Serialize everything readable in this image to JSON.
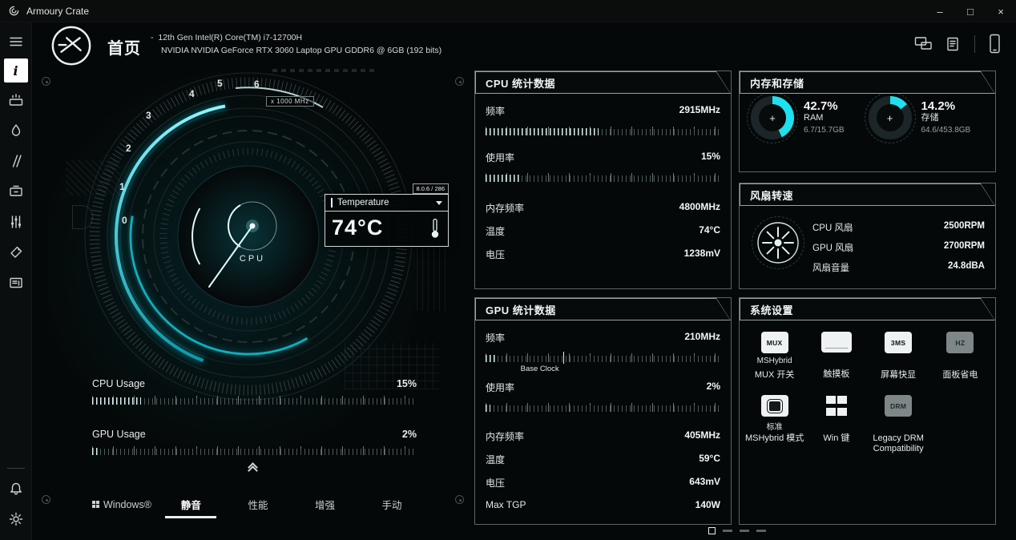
{
  "window": {
    "title": "Armoury Crate",
    "minimize": "–",
    "maximize": "□",
    "close": "×"
  },
  "header": {
    "page_title": "首页",
    "bullet": "-",
    "cpu_info": "12th Gen Intel(R) Core(TM) i7-12700H",
    "gpu_info": "NVIDIA NVIDIA GeForce RTX 3060 Laptop GPU GDDR6 @ 6GB (192 bits)"
  },
  "gauge": {
    "ticks": [
      "0",
      "1",
      "2",
      "3",
      "4",
      "5",
      "6"
    ],
    "scale_label": "x 1000 MHz",
    "center_label": "CPU",
    "tooltip": {
      "meta": "8.0.6 / 286",
      "title": "Temperature",
      "value": "74°C"
    }
  },
  "usage": {
    "cpu": {
      "label": "CPU Usage",
      "value": "15%",
      "percent": 15
    },
    "gpu": {
      "label": "GPU Usage",
      "value": "2%",
      "percent": 2
    }
  },
  "modes": {
    "items": [
      {
        "label": "Windows®"
      },
      {
        "label": "静音"
      },
      {
        "label": "性能"
      },
      {
        "label": "增强"
      },
      {
        "label": "手动"
      }
    ]
  },
  "panels": {
    "cpu": {
      "title": "CPU 统计数据",
      "freq": {
        "label": "频率",
        "value": "2915MHz",
        "percent": 48
      },
      "load": {
        "label": "使用率",
        "value": "15%",
        "percent": 15
      },
      "rows": [
        {
          "label": "内存频率",
          "value": "4800MHz"
        },
        {
          "label": "温度",
          "value": "74°C"
        },
        {
          "label": "电压",
          "value": "1238mV"
        }
      ]
    },
    "gpu": {
      "title": "GPU 统计数据",
      "freq": {
        "label": "频率",
        "value": "210MHz",
        "percent": 5,
        "marker_label": "Base Clock",
        "marker_percent": 33
      },
      "load": {
        "label": "使用率",
        "value": "2%",
        "percent": 2
      },
      "rows": [
        {
          "label": "内存频率",
          "value": "405MHz"
        },
        {
          "label": "温度",
          "value": "59°C"
        },
        {
          "label": "电压",
          "value": "643mV"
        },
        {
          "label": "Max TGP",
          "value": "140W"
        }
      ]
    },
    "memory": {
      "title": "内存和存储",
      "items": [
        {
          "percent_text": "42.7%",
          "percent": 42.7,
          "label": "RAM",
          "detail": "6.7/15.7GB",
          "center": "+"
        },
        {
          "percent_text": "14.2%",
          "percent": 14.2,
          "label": "存储",
          "detail": "64.6/453.8GB",
          "center": "+"
        }
      ]
    },
    "fan": {
      "title": "风扇转速",
      "rows": [
        {
          "label": "CPU 风扇",
          "value": "2500RPM"
        },
        {
          "label": "GPU 风扇",
          "value": "2700RPM"
        },
        {
          "label": "风扇音量",
          "value": "24.8dBA"
        }
      ]
    },
    "system": {
      "title": "系统设置",
      "items": [
        {
          "chip": "MUX",
          "sub": "MSHybrid",
          "label": "MUX 开关"
        },
        {
          "chip": "touchpad",
          "sub": "",
          "label": "触摸板"
        },
        {
          "chip": "3MS",
          "sub": "",
          "label": "屏幕快显"
        },
        {
          "chip": "HZ",
          "sub": "",
          "label": "面板省电"
        },
        {
          "chip": "cpu",
          "sub": "标准",
          "label": "MSHybrid 模式"
        },
        {
          "chip": "windows",
          "sub": "",
          "label": "Win 键"
        },
        {
          "chip": "DRM",
          "sub": "",
          "label": "Legacy DRM Compatibility"
        }
      ]
    }
  },
  "colors": {
    "accent": "#1fe0ee",
    "ring_track": "#1c2628"
  }
}
